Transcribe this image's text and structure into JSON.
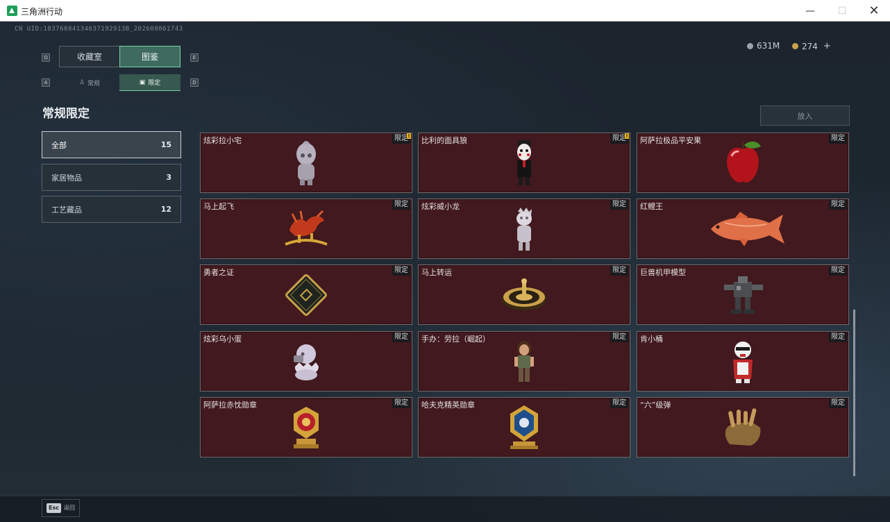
{
  "window": {
    "title": "三角洲行动",
    "minimize": "—",
    "maximize": "☐",
    "close": "✕"
  },
  "uid": "CN UID:18376084134637192913B_202608061743",
  "currency": {
    "silver": "631M",
    "gold": "274",
    "plus": "+"
  },
  "keys": {
    "tab_left": "Q",
    "tab_right": "E",
    "sub_left": "A",
    "sub_right": "D",
    "esc": "Esc"
  },
  "tabs": [
    {
      "label": "收藏室"
    },
    {
      "label": "图鉴"
    }
  ],
  "subtabs": [
    {
      "label": "常规",
      "icon": "trophy-icon"
    },
    {
      "label": "限定",
      "icon": "frame-icon"
    }
  ],
  "section_title": "常规限定",
  "categories": [
    {
      "label": "全部",
      "count": "15"
    },
    {
      "label": "家居物品",
      "count": "3"
    },
    {
      "label": "工艺藏品",
      "count": "12"
    }
  ],
  "place_button": "放入",
  "back_label": "返回",
  "items": [
    {
      "name": "炫彩拉小宅",
      "tag": "限定",
      "alert": "!"
    },
    {
      "name": "比利的面具狼",
      "tag": "限定",
      "alert": "!"
    },
    {
      "name": "阿萨拉极品平安果",
      "tag": "限定"
    },
    {
      "name": "马上起飞",
      "tag": "限定"
    },
    {
      "name": "炫彩威小龙",
      "tag": "限定"
    },
    {
      "name": "红鲤王",
      "tag": "限定"
    },
    {
      "name": "勇者之证",
      "tag": "限定"
    },
    {
      "name": "马上转运",
      "tag": "限定"
    },
    {
      "name": "巨兽机甲模型",
      "tag": "限定"
    },
    {
      "name": "炫彩乌小蛋",
      "tag": "限定"
    },
    {
      "name": "手办：劳拉（崛起）",
      "tag": "限定"
    },
    {
      "name": "肯小桶",
      "tag": "限定"
    },
    {
      "name": "阿萨拉赤忱勋章",
      "tag": "限定"
    },
    {
      "name": "哈夫克精英勋章",
      "tag": "限定"
    },
    {
      "name": "“六”级弹",
      "tag": "限定"
    }
  ]
}
